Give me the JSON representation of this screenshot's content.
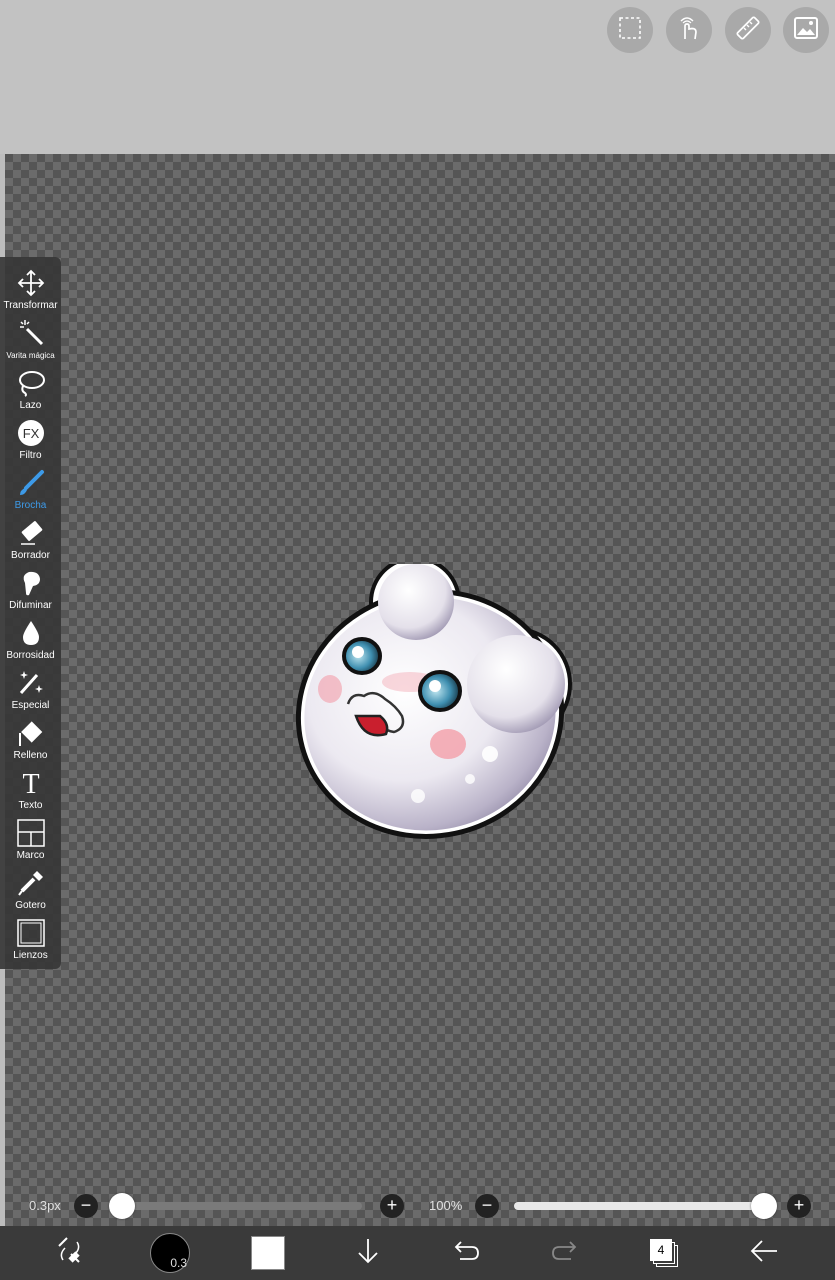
{
  "top_actions": [
    {
      "name": "selection-icon"
    },
    {
      "name": "hand-gesture-icon"
    },
    {
      "name": "ruler-icon"
    },
    {
      "name": "image-icon"
    }
  ],
  "tools": [
    {
      "id": "transformar",
      "label": "Transformar",
      "icon": "move-arrows-icon"
    },
    {
      "id": "varita",
      "label": "Varita mágica",
      "icon": "magic-wand-icon"
    },
    {
      "id": "lazo",
      "label": "Lazo",
      "icon": "lasso-icon"
    },
    {
      "id": "filtro",
      "label": "Filtro",
      "icon": "fx-icon",
      "icon_text": "FX"
    },
    {
      "id": "brocha",
      "label": "Brocha",
      "icon": "brush-icon",
      "active": true
    },
    {
      "id": "borrador",
      "label": "Borrador",
      "icon": "eraser-icon"
    },
    {
      "id": "difuminar",
      "label": "Difuminar",
      "icon": "smudge-icon"
    },
    {
      "id": "borrosidad",
      "label": "Borrosidad",
      "icon": "blur-drop-icon"
    },
    {
      "id": "especial",
      "label": "Especial",
      "icon": "sparkle-pen-icon"
    },
    {
      "id": "relleno",
      "label": "Relleno",
      "icon": "fill-bucket-icon"
    },
    {
      "id": "texto",
      "label": "Texto",
      "icon": "text-icon",
      "icon_text": "T"
    },
    {
      "id": "marco",
      "label": "Marco",
      "icon": "frame-divider-icon"
    },
    {
      "id": "gotero",
      "label": "Gotero",
      "icon": "eyedropper-icon"
    },
    {
      "id": "lienzos",
      "label": "Lienzos",
      "icon": "canvas-icon"
    }
  ],
  "brush_size": {
    "value": "0.3px",
    "level": 0.0
  },
  "opacity": {
    "value": "100%",
    "level": 1.0
  },
  "bottom": {
    "brush_indicator": "0.3",
    "layers_count": "4",
    "primary_color": "#ffffff",
    "accent": "#3d9ae8"
  }
}
